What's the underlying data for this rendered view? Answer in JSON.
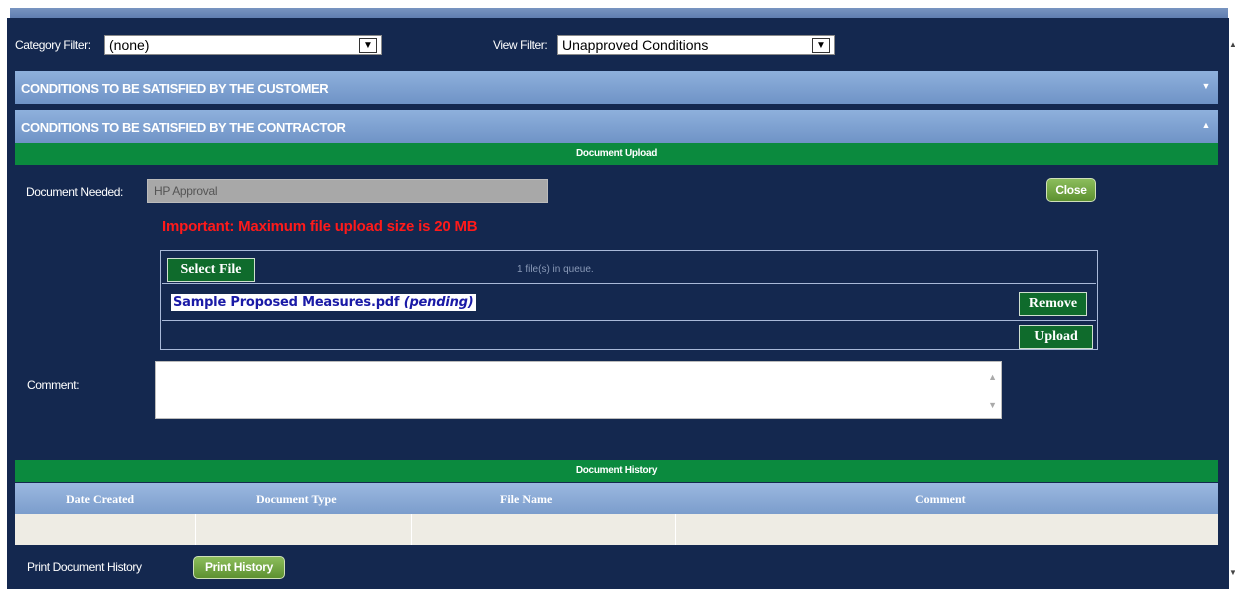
{
  "filters": {
    "category_label": "Category Filter:",
    "category_value": "(none)",
    "view_label": "View Filter:",
    "view_value": "Unapproved Conditions"
  },
  "sections": {
    "customer": "CONDITIONS TO BE SATISFIED BY THE CUSTOMER",
    "contractor": "CONDITIONS TO BE SATISFIED BY THE CONTRACTOR"
  },
  "upload": {
    "title": "Document Upload",
    "doc_needed_label": "Document Needed:",
    "doc_needed_value": "HP Approval",
    "close_label": "Close",
    "important": "Important: Maximum file upload size is 20 MB",
    "select_file_label": "Select File",
    "queue_text": "1 file(s) in queue.",
    "file_name": "Sample Proposed Measures.pdf",
    "file_status": "(pending)",
    "remove_label": "Remove",
    "upload_label": "Upload",
    "comment_label": "Comment:"
  },
  "history": {
    "title": "Document History",
    "columns": [
      "Date Created",
      "Document Type",
      "File Name",
      "Comment"
    ],
    "print_label": "Print Document History",
    "print_button": "Print History"
  },
  "colors": {
    "panel_bg": "#14284f",
    "accordion": "#7b9dcc",
    "green_bar": "#0b8a3e",
    "important_text": "#ff1a1a"
  },
  "icons": {
    "select_arrow": "chevron-down-icon",
    "collapse": "triangle-up-icon",
    "expand": "triangle-down-icon"
  }
}
